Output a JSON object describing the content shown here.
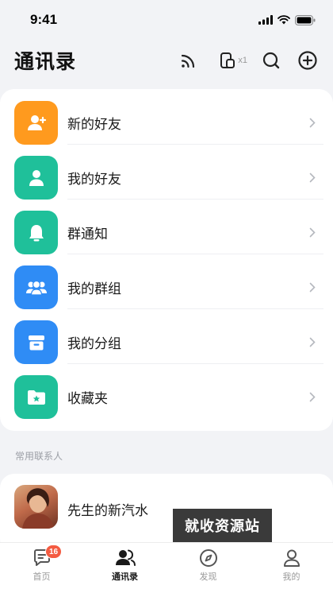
{
  "status_bar": {
    "time": "9:41"
  },
  "header": {
    "title": "通讯录",
    "device_count": "x1"
  },
  "menu": {
    "items": [
      {
        "label": "新的好友",
        "icon": "add-friend-icon",
        "color": "#ff9a1e"
      },
      {
        "label": "我的好友",
        "icon": "person-icon",
        "color": "#1fc09a"
      },
      {
        "label": "群通知",
        "icon": "bell-icon",
        "color": "#1fc09a"
      },
      {
        "label": "我的群组",
        "icon": "group-icon",
        "color": "#2f8cf5"
      },
      {
        "label": "我的分组",
        "icon": "box-icon",
        "color": "#2f8cf5"
      },
      {
        "label": "收藏夹",
        "icon": "folder-star-icon",
        "color": "#1fc09a"
      }
    ]
  },
  "section": {
    "frequent_contacts_label": "常用联系人"
  },
  "contacts": [
    {
      "name": "先生的新汽水"
    }
  ],
  "watermark": {
    "text": "就收资源站"
  },
  "tabbar": {
    "items": [
      {
        "label": "首页",
        "icon": "chat-icon",
        "badge": "16"
      },
      {
        "label": "通讯录",
        "icon": "contacts-icon",
        "active": true
      },
      {
        "label": "发现",
        "icon": "compass-icon"
      },
      {
        "label": "我的",
        "icon": "profile-icon"
      }
    ]
  }
}
